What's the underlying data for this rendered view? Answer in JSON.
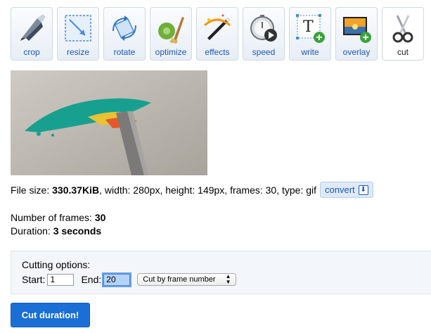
{
  "toolbar": {
    "tools": [
      {
        "label": "crop",
        "icon": "crop-icon"
      },
      {
        "label": "resize",
        "icon": "resize-icon"
      },
      {
        "label": "rotate",
        "icon": "rotate-icon"
      },
      {
        "label": "optimize",
        "icon": "optimize-icon"
      },
      {
        "label": "effects",
        "icon": "effects-icon"
      },
      {
        "label": "speed",
        "icon": "speed-icon"
      },
      {
        "label": "write",
        "icon": "write-icon"
      },
      {
        "label": "overlay",
        "icon": "overlay-icon"
      },
      {
        "label": "cut",
        "icon": "scissors-icon"
      }
    ],
    "active": "cut"
  },
  "fileinfo": {
    "size_prefix": "File size: ",
    "size": "330.37KiB",
    "rest": ", width: 280px, height: 149px, frames: 30, type: gif",
    "convert_label": "convert"
  },
  "stats": {
    "frames_label": "Number of frames: ",
    "frames": "30",
    "duration_label": "Duration: ",
    "duration": "3 seconds"
  },
  "cutting": {
    "title": "Cutting options:",
    "start_label": "Start:",
    "start_value": "1",
    "end_label": "End:",
    "end_value": "20",
    "mode": "Cut by frame number"
  },
  "submit_label": "Cut duration!",
  "colors": {
    "link": "#1a58b5",
    "button": "#1a6fd6",
    "panel": "#f3f6fa"
  }
}
